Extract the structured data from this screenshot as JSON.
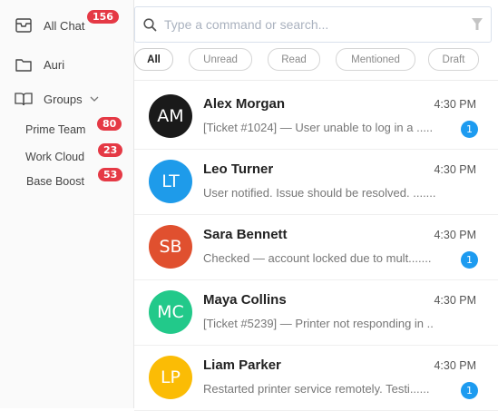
{
  "sidebar": {
    "all_chat": {
      "label": "All Chat",
      "badge": "156",
      "icon": "inbox-icon"
    },
    "auri": {
      "label": "Auri",
      "icon": "folder-icon"
    },
    "groups": {
      "label": "Groups",
      "icon": "book-icon"
    },
    "group_items": [
      {
        "label": "Prime Team",
        "badge": "80"
      },
      {
        "label": "Work Cloud",
        "badge": "23"
      },
      {
        "label": "Base Boost",
        "badge": "53"
      }
    ]
  },
  "search": {
    "placeholder": "Type a command or search..."
  },
  "filters": [
    "All",
    "Unread",
    "Read",
    "Mentioned",
    "Draft"
  ],
  "conversations": [
    {
      "initials": "AM",
      "name": "Alex Morgan",
      "time": "4:30 PM",
      "preview": "[Ticket #1024] — User unable to log in a .....",
      "unread": "1",
      "color": "#1a1a1a"
    },
    {
      "initials": "LT",
      "name": "Leo Turner",
      "time": "4:30 PM",
      "preview": "User notified. Issue should be resolved. .......",
      "unread": "",
      "color": "#1e9bea"
    },
    {
      "initials": "SB",
      "name": "Sara Bennett",
      "time": "4:30 PM",
      "preview": "Checked — account locked due to mult.......",
      "unread": "1",
      "color": "#e0502f"
    },
    {
      "initials": "MC",
      "name": "Maya Collins",
      "time": "4:30 PM",
      "preview": "[Ticket #5239] — Printer not responding in ..",
      "unread": "",
      "color": "#22c98a"
    },
    {
      "initials": "LP",
      "name": "Liam Parker",
      "time": "4:30 PM",
      "preview": "Restarted printer service remotely. Testi......",
      "unread": "1",
      "color": "#fbbc05"
    }
  ],
  "colors": {
    "badge": "#e53945",
    "unread": "#1d9bf0"
  }
}
